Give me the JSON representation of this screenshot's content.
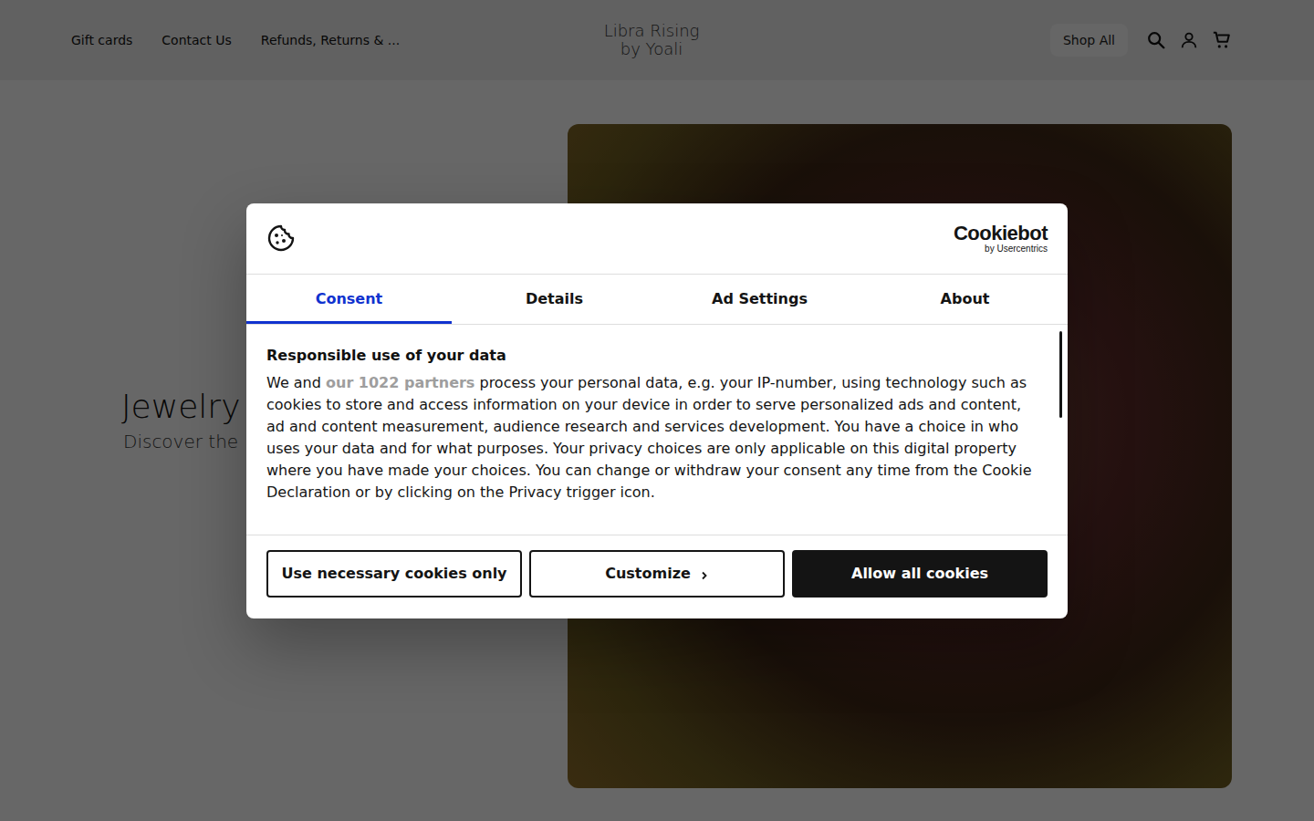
{
  "header": {
    "nav": [
      "Gift cards",
      "Contact Us",
      "Refunds, Returns & ..."
    ],
    "logo": [
      "Libra Rising",
      "by Yoali"
    ],
    "shop_button": "Shop All"
  },
  "hero": {
    "title": "Jewelry",
    "subtitle": "Discover the"
  },
  "cookie_dialog": {
    "brand": {
      "name": "Cookiebot",
      "by": "by Usercentrics"
    },
    "tabs": [
      {
        "label": "Consent",
        "selected": true
      },
      {
        "label": "Details",
        "selected": false
      },
      {
        "label": "Ad Settings",
        "selected": false
      },
      {
        "label": "About",
        "selected": false
      }
    ],
    "heading": "Responsible use of your data",
    "body": {
      "before": "We and ",
      "link": "our 1022 partners",
      "after": " process your personal data, e.g. your IP-number, using technology such as cookies to store and access information on your device in order to serve personalized ads and content, ad and content measurement, audience research and services development. You have a choice in who uses your data and for what purposes. Your privacy choices are only applicable on this digital property where you have made your choices. You can change or withdraw your consent any time from the Cookie Declaration or by clicking on the Privacy trigger icon."
    },
    "buttons": [
      {
        "label": "Use necessary cookies only",
        "kind": "outline"
      },
      {
        "label": "Customize",
        "kind": "chevron"
      },
      {
        "label": "Allow all cookies",
        "kind": "filled"
      }
    ]
  }
}
